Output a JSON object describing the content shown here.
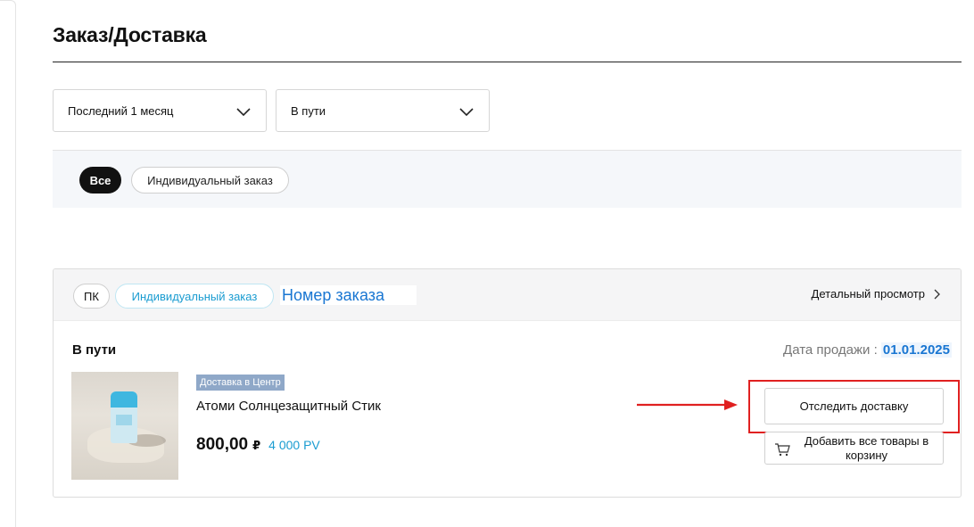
{
  "page": {
    "title": "Заказ/Доставка"
  },
  "filters": {
    "period": {
      "selected": "Последний 1 месяц",
      "icon": "chevron-down-icon"
    },
    "status": {
      "selected": "В пути",
      "icon": "chevron-down-icon"
    }
  },
  "order_type_tabs": [
    {
      "label": "Все",
      "active": true
    },
    {
      "label": "Индивидуальный заказ",
      "active": false
    }
  ],
  "order": {
    "channel_tag": "ПК",
    "type_tag": "Индивидуальный заказ",
    "order_number_label": "Номер заказа",
    "detail_link": "Детальный просмотр",
    "status": "В пути",
    "sale_date_label": "Дата продажи :",
    "sale_date": "01.01.2025",
    "product": {
      "delivery_badge": "Доставка в Центр",
      "name": "Атоми Солнцезащитный Стик",
      "price": "800,00",
      "currency": "₽",
      "pv": "4 000 PV"
    },
    "actions": {
      "track": "Отследить доставку",
      "add_to_cart": "Добавить все товары в корзину"
    }
  },
  "colors": {
    "accent_blue": "#1a9cd1",
    "highlight_red": "#e02020",
    "filter_bg": "#f5f7fa"
  }
}
